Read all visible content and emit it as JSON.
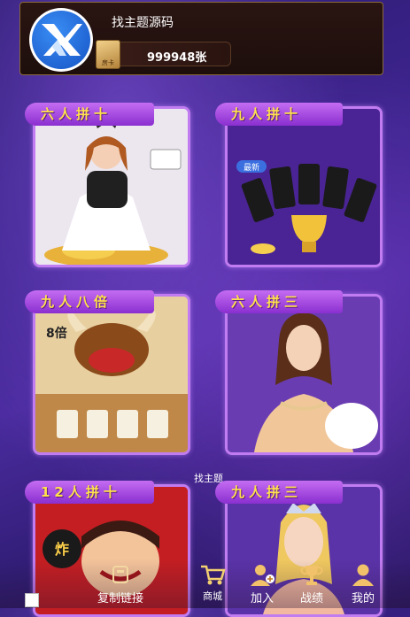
{
  "header": {
    "title": "找主题源码",
    "coins": "999948张",
    "card_icon_label": "房卡"
  },
  "tiles": [
    {
      "label": "六人拼十"
    },
    {
      "label": "九人拼十"
    },
    {
      "label": "九人八倍"
    },
    {
      "label": "六人拼三"
    },
    {
      "label": "12人拼十"
    },
    {
      "label": "九人拼三"
    }
  ],
  "tile_extras": {
    "new_badge": "最新",
    "eight_times": "8倍",
    "explosion": "炸"
  },
  "center_label": "找主题",
  "nav": {
    "copy_link": "复制链接",
    "shop": "商城",
    "join": "加入",
    "record": "战绩",
    "mine": "我的"
  },
  "colors": {
    "tile_border": "#c07cf0",
    "banner_text": "#ffe24a",
    "banner_bg": "#a84ce0",
    "header_bg": "#1d0e0c"
  }
}
